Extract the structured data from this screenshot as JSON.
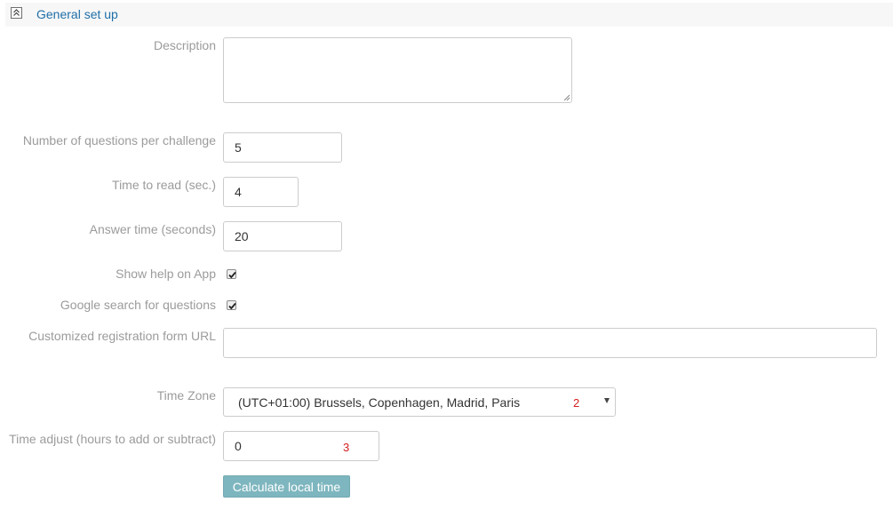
{
  "section": {
    "title": "General set up",
    "collapse_icon": "collapse-up-icon"
  },
  "fields": {
    "description": {
      "label": "Description",
      "value": ""
    },
    "questions_per_challenge": {
      "label": "Number of questions per challenge",
      "value": "5"
    },
    "time_to_read": {
      "label": "Time to read (sec.)",
      "value": "4"
    },
    "answer_time": {
      "label": "Answer time (seconds)",
      "value": "20"
    },
    "show_help": {
      "label": "Show help on App",
      "checked": true
    },
    "google_search": {
      "label": "Google search for questions",
      "checked": true
    },
    "registration_url": {
      "label": "Customized registration form URL",
      "value": ""
    },
    "time_zone": {
      "label": "Time Zone",
      "selected": "(UTC+01:00) Brussels, Copenhagen, Madrid, Paris",
      "marker": "2"
    },
    "time_adjust": {
      "label": "Time adjust (hours to add or subtract)",
      "value": "0",
      "marker": "3"
    }
  },
  "buttons": {
    "calculate_local_time": "Calculate local time"
  },
  "colors": {
    "link": "#1f6fa8",
    "label": "#9b9b9b",
    "button": "#7eb6bf",
    "marker": "#d42020"
  }
}
